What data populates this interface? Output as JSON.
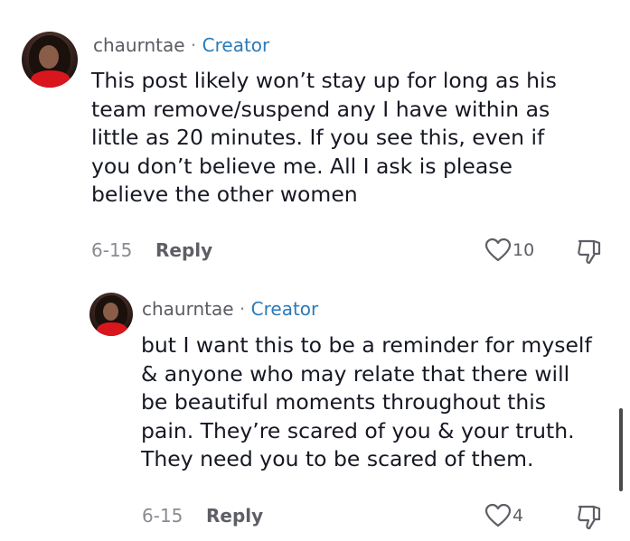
{
  "comments": [
    {
      "username": "chaurntae",
      "separator": "·",
      "badge": "Creator",
      "lines": [
        "This post likely won’t stay up for long as his",
        "team remove/suspend any I have within as",
        "little as 20 minutes. If you see this, even if",
        "you don’t believe me. All I ask is please",
        "believe the other women"
      ],
      "date": "6-15",
      "reply_label": "Reply",
      "likes": "10"
    },
    {
      "username": "chaurntae",
      "separator": "·",
      "badge": "Creator",
      "lines": [
        "but I want this to be a reminder for myself",
        "& anyone who may relate that there will",
        "be beautiful moments throughout this",
        "pain. They’re scared of you & your truth.",
        "They need you to be scared of them."
      ],
      "date": "6-15",
      "reply_label": "Reply",
      "likes": "4"
    }
  ],
  "icons": {
    "like": "heart-outline-icon",
    "dislike": "thumbs-down-outline-icon"
  },
  "colors": {
    "creator": "#2b7ab8",
    "username": "#5b5b63",
    "muted": "#8a8b91"
  }
}
